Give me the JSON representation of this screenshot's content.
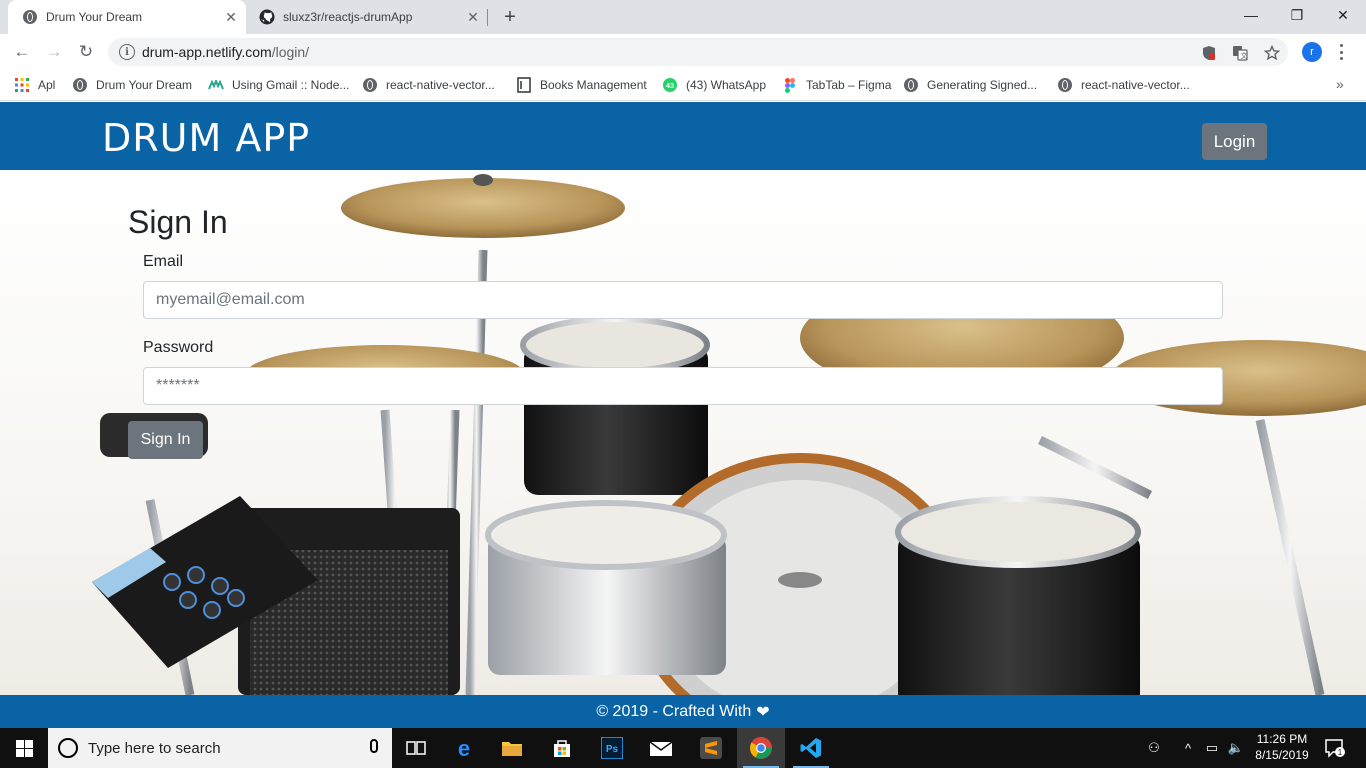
{
  "browser": {
    "tabs": [
      {
        "title": "Drum Your Dream",
        "active": true,
        "icon": "globe-icon"
      },
      {
        "title": "sluxz3r/reactjs-drumApp",
        "active": false,
        "icon": "github-icon"
      }
    ],
    "close_glyph": "✕",
    "new_tab_glyph": "+",
    "window_controls": {
      "minimize": "—",
      "maximize": "❐",
      "close": "✕"
    },
    "nav": {
      "back": "←",
      "forward": "→",
      "reload": "↻"
    },
    "address": {
      "host": "drum-app.netlify.com",
      "path": "/login/"
    },
    "profile_initial": "r",
    "bookmarks": [
      {
        "label": "Apl",
        "icon": "apps-grid-icon"
      },
      {
        "label": "Drum Your Dream",
        "icon": "globe-icon"
      },
      {
        "label": "Using Gmail :: Node...",
        "icon": "nodemailer-icon"
      },
      {
        "label": "react-native-vector...",
        "icon": "globe-icon"
      },
      {
        "label": "Books Management",
        "icon": "document-icon"
      },
      {
        "label": "(43) WhatsApp",
        "icon": "whatsapp-icon",
        "badge": "43"
      },
      {
        "label": "TabTab – Figma",
        "icon": "figma-icon"
      },
      {
        "label": "Generating Signed...",
        "icon": "globe-icon"
      },
      {
        "label": "react-native-vector...",
        "icon": "globe-icon"
      }
    ],
    "bookmarks_more": "»"
  },
  "app": {
    "brand": "DRUM APP",
    "login_label": "Login",
    "form": {
      "title": "Sign In",
      "email_label": "Email",
      "email_placeholder": "myemail@email.com",
      "password_label": "Password",
      "password_placeholder": "*******",
      "submit_label": "Sign In"
    },
    "footer": {
      "text": "© 2019 - Crafted With",
      "heart": "❤"
    },
    "colors": {
      "primary": "#0a63a5",
      "button_gray": "#6c757d"
    }
  },
  "taskbar": {
    "search_placeholder": "Type here to search",
    "apps": [
      "task-view",
      "edge",
      "file-explorer",
      "store",
      "photoshop",
      "mail",
      "sublime-text",
      "chrome",
      "vscode"
    ],
    "tray": {
      "people": "⚇",
      "chevron": "^",
      "battery": "▭",
      "volume": "🔈"
    },
    "clock": {
      "time": "11:26 PM",
      "date": "8/15/2019"
    },
    "notification_count": "1"
  }
}
